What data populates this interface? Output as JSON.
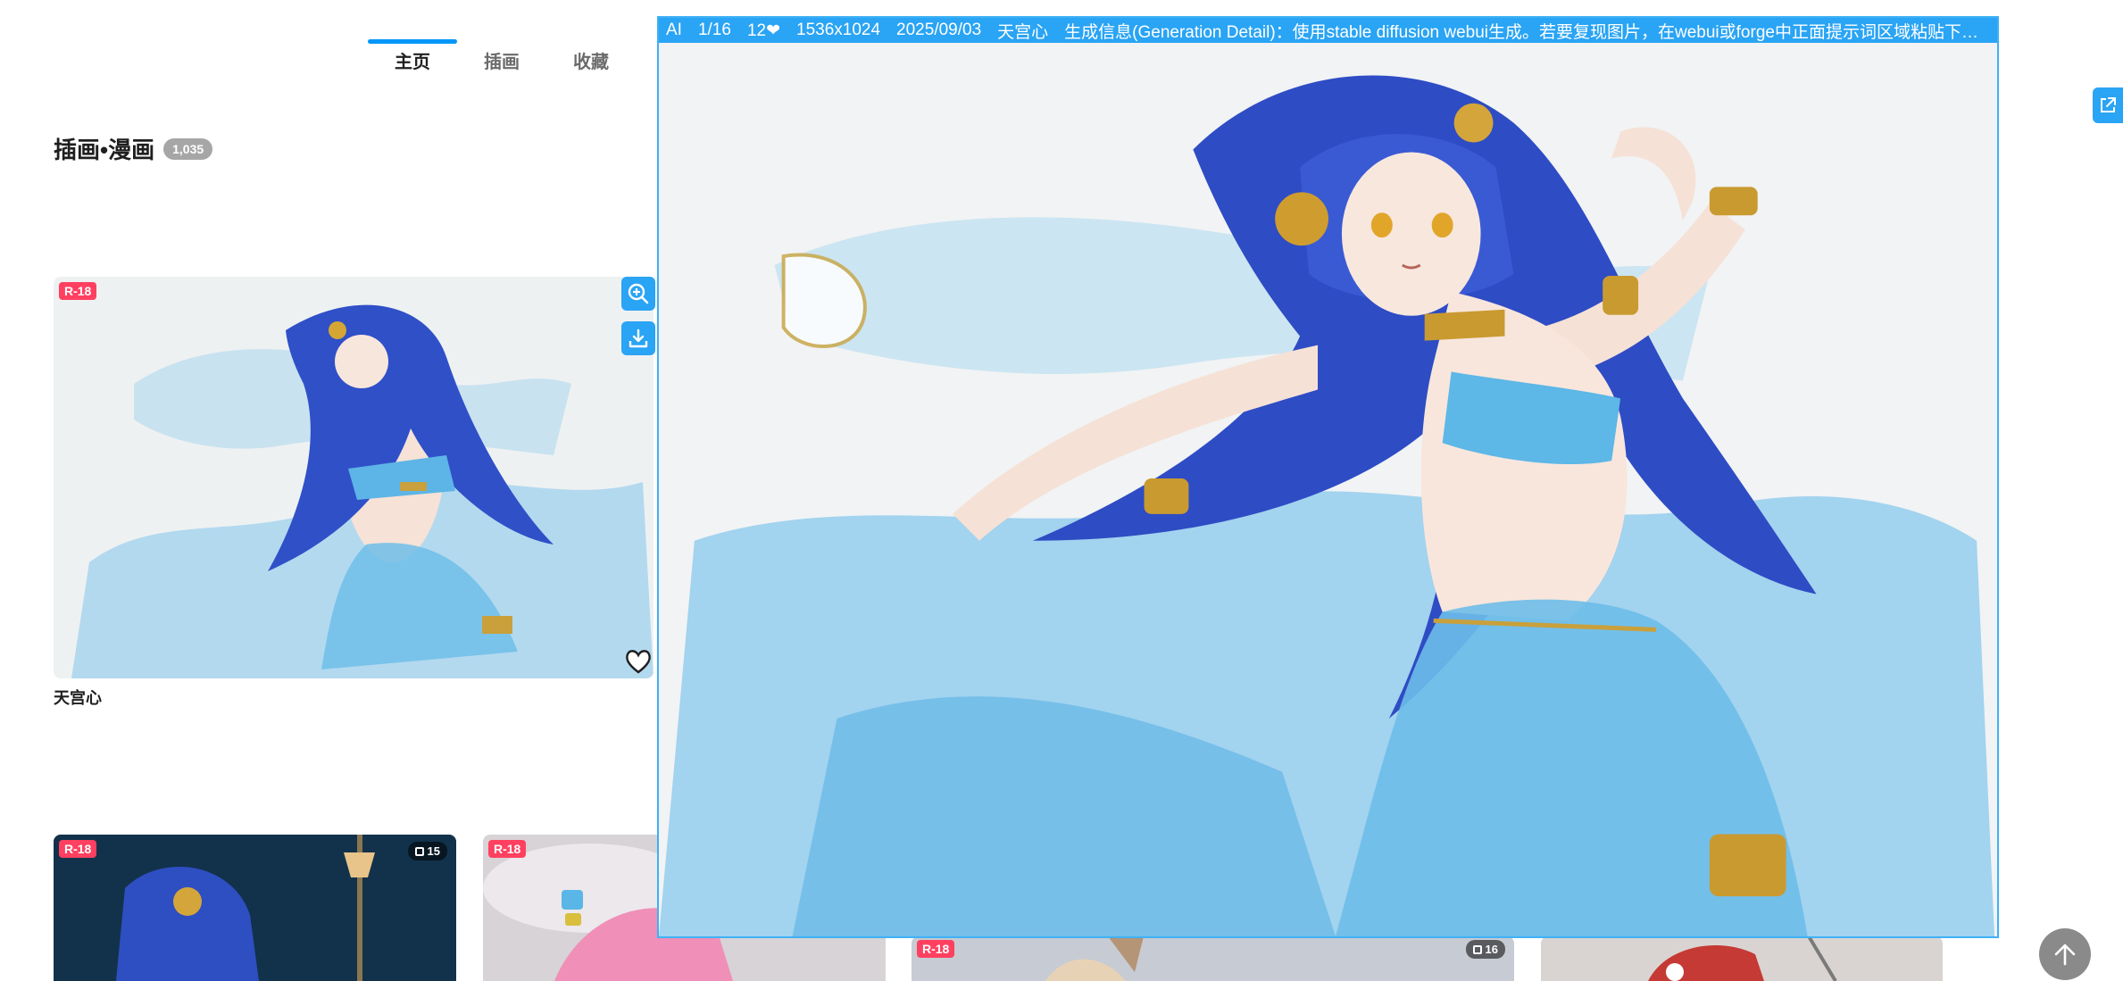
{
  "nav": {
    "tabs": [
      {
        "label": "主页",
        "active": true
      },
      {
        "label": "插画",
        "active": false
      },
      {
        "label": "收藏",
        "active": false
      }
    ]
  },
  "section": {
    "title": "插画•漫画",
    "count": "1,035"
  },
  "featured": {
    "badge": "R-18",
    "author": "天宫心",
    "icons": [
      "zoom-in-icon",
      "download-icon",
      "heart-icon"
    ]
  },
  "thumbnails": [
    {
      "badge": "R-18",
      "pages": "15"
    },
    {
      "badge": "R-18",
      "pages": ""
    },
    {
      "badge": "R-18",
      "pages": "16"
    },
    {
      "badge": "",
      "pages": ""
    }
  ],
  "preview": {
    "ai_label": "AI",
    "page": "1/16",
    "likes": "12❤",
    "size": "1536x1024",
    "date": "2025/09/03",
    "author": "天宫心",
    "detail": "生成信息(Generation Detail)：使用stable diffusion webui生成。若要复现图片，在webui或forge中正面提示词区域粘贴下面内容，然..."
  },
  "colors": {
    "accent": "#0096fa",
    "preview_border": "#3fb1f5",
    "r18": "#ff4060",
    "hair": "#2f4fc4",
    "cloth": "#7cc3ea"
  },
  "controls": {
    "open_icon": "external-link-icon",
    "top_icon": "arrow-up-icon"
  }
}
